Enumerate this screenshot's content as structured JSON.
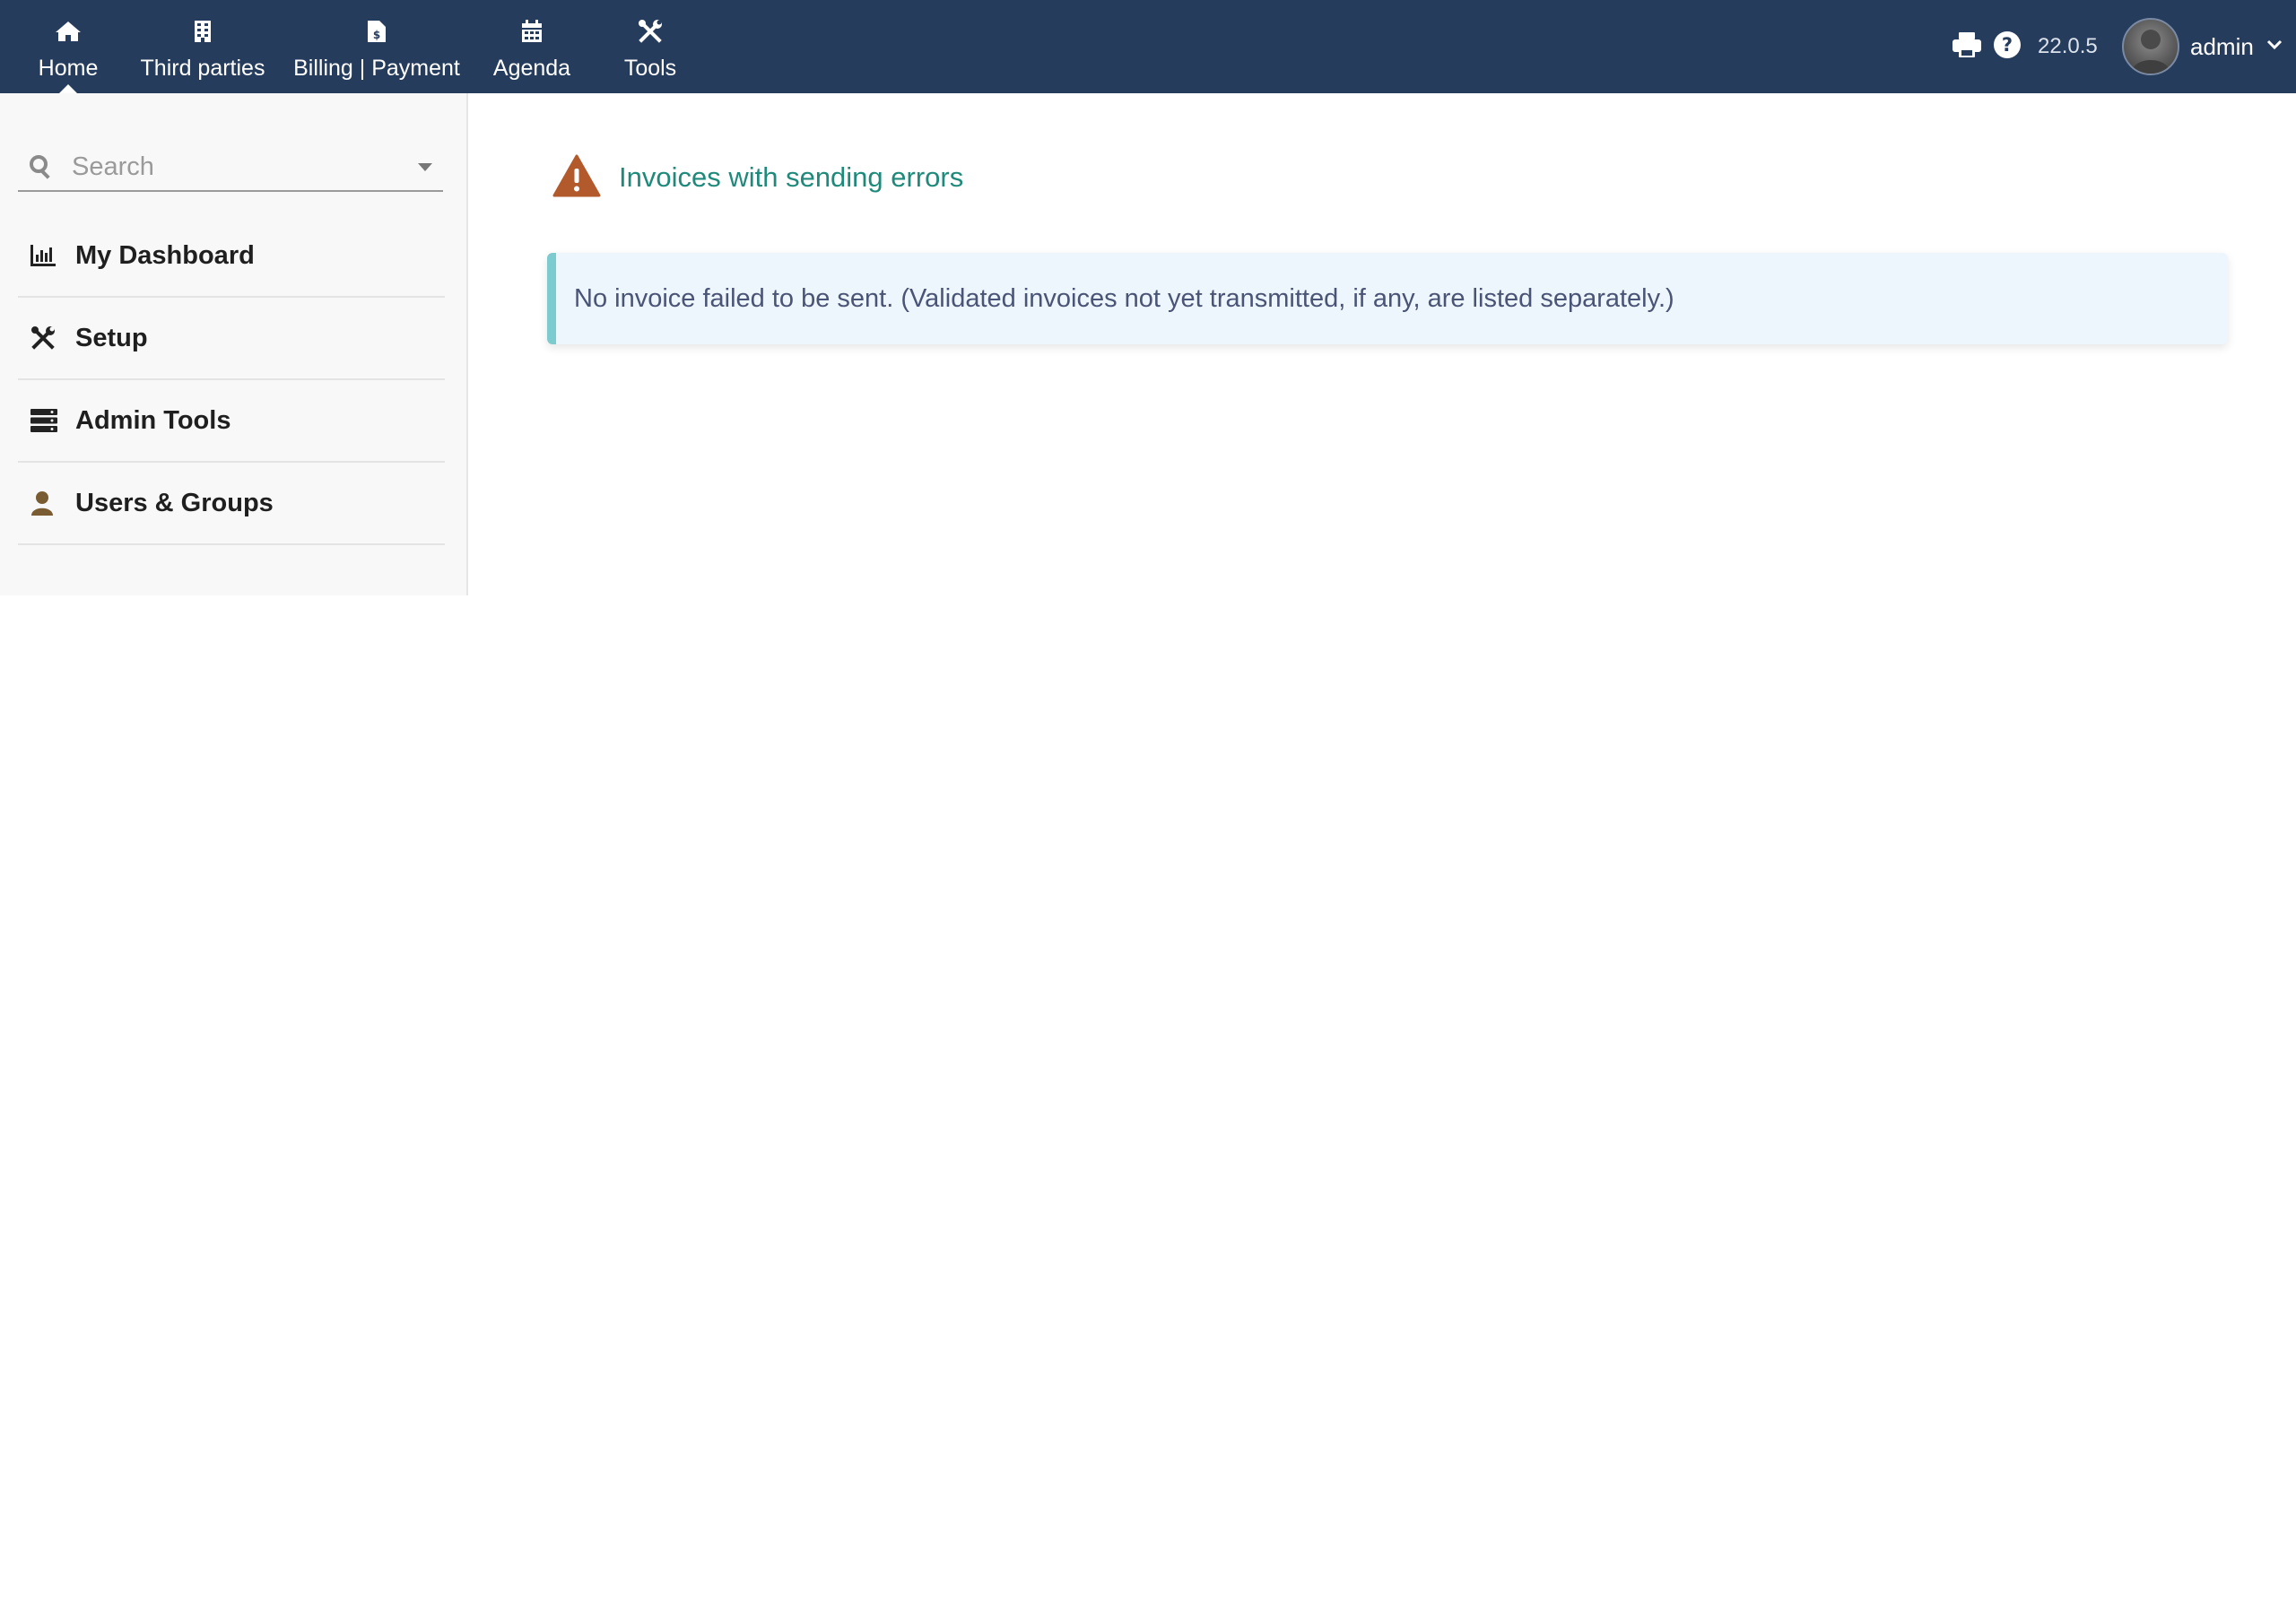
{
  "topmenu": [
    {
      "label": "Home",
      "icon": "home-icon",
      "active": true
    },
    {
      "label": "Third parties",
      "icon": "building-icon"
    },
    {
      "label": "Billing | Payment",
      "icon": "invoice-dollar-icon"
    },
    {
      "label": "Agenda",
      "icon": "calendar-icon"
    },
    {
      "label": "Tools",
      "icon": "tools-icon"
    }
  ],
  "topright": {
    "version": "22.0.5",
    "user": "admin"
  },
  "sidebar": {
    "search_placeholder": "Search",
    "items": [
      {
        "label": "My Dashboard",
        "icon": "chart-bar-icon"
      },
      {
        "label": "Setup",
        "icon": "tools-icon"
      },
      {
        "label": "Admin Tools",
        "icon": "server-icon"
      },
      {
        "label": "Users & Groups",
        "icon": "user-icon"
      }
    ]
  },
  "main": {
    "title": "Invoices with sending errors",
    "info_message": "No invoice failed to be sent. (Validated invoices not yet transmitted, if any, are listed separately.)"
  },
  "colors": {
    "topbar": "#263c5c",
    "title": "#1f8a7c",
    "warning_icon": "#b25a2c",
    "info_border": "#7ccbcf",
    "info_bg": "#eef6fd",
    "users_icon": "#7a5c32"
  }
}
